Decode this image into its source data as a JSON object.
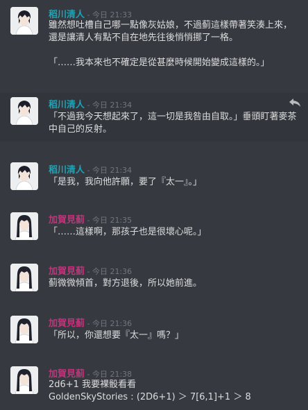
{
  "messages": [
    {
      "author": "稻川清人",
      "separator": " - ",
      "timestamp": "今日 21:33",
      "lines": [
        "雖然想吐槽自己哪一點像灰姑娘，不過蓟這樣帶著笑湊上來，還是讓清人有點不自在地先往後悄悄挪了一格。",
        "「……我本來也不確定是從甚麼時候開始變成這樣的。」"
      ]
    },
    {
      "author": "稻川清人",
      "separator": " - ",
      "timestamp": "今日 21:34",
      "lines": [
        "「不過我今天想起來了，這一切是我咎由自取。」垂頭盯著麥茶中自己的反射。"
      ]
    },
    {
      "author": "稻川清人",
      "separator": " - ",
      "timestamp": "今日 21:34",
      "lines": [
        "「是我，我向他許願，要了『太一』。」"
      ]
    },
    {
      "author": "加賀見蓟",
      "separator": " - ",
      "timestamp": "今日 21:35",
      "lines": [
        "「……這樣啊，那孩子也是很壞心呢。」"
      ]
    },
    {
      "author": "加賀見蓟",
      "separator": " - ",
      "timestamp": "今日 21:36",
      "lines": [
        "蓟微微傾首，對方退後，所以她前進。"
      ]
    },
    {
      "author": "加賀見蓟",
      "separator": " - ",
      "timestamp": "今日 21:36",
      "lines": [
        "「所以，你還想要『太一』嗎？」"
      ]
    },
    {
      "author": "加賀見蓟",
      "separator": " - ",
      "timestamp": "今日 21:38",
      "lines": [
        "2d6+1 我要裸骰看看",
        "GoldenSkyStories : (2D6+1) ＞ 7[6,1]+1 ＞ 8"
      ]
    }
  ],
  "icons": {
    "reply": "reply-arrow-icon",
    "avatar_kiyoto": "avatar-dark-haired-boy",
    "avatar_kaga": "avatar-long-haired-woman"
  },
  "colors": {
    "background": "#36393f",
    "kiyoto_name": "#1fa2b5",
    "kaga_name": "#c2337c",
    "text": "#dcddde",
    "muted": "#72767d"
  }
}
